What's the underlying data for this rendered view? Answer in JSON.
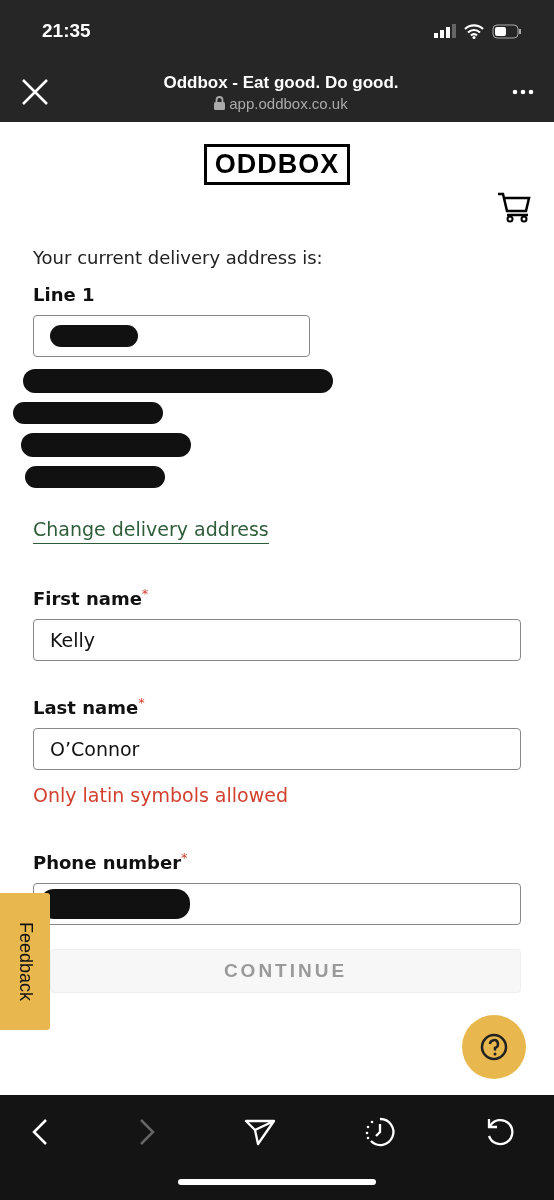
{
  "status_bar": {
    "time": "21:35"
  },
  "browser": {
    "title": "Oddbox - Eat good. Do good.",
    "url": "app.oddbox.co.uk"
  },
  "logo": "ODDBOX",
  "address": {
    "intro": "Your current delivery address is:",
    "line1_label": "Line 1",
    "change_link": "Change delivery address"
  },
  "fields": [
    {
      "label": "First name",
      "required_mark": "*",
      "value": "Kelly"
    },
    {
      "label": "Last name",
      "required_mark": "*",
      "value": "O’Connor",
      "error": "Only latin symbols allowed"
    },
    {
      "label": "Phone number",
      "required_mark": "*"
    }
  ],
  "continue_button": {
    "label": "CONTINUE",
    "disabled": true
  },
  "feedback_tab": "Feedback",
  "toolbar": {
    "back_disabled": false,
    "forward_disabled": true
  }
}
